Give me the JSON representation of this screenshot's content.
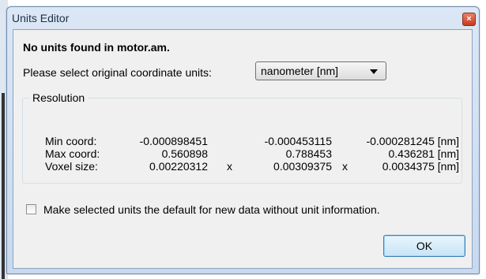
{
  "window": {
    "title": "Units Editor",
    "close_glyph": "×"
  },
  "dialog": {
    "heading": "No units found in motor.am.",
    "units_label": "Please select original coordinate units:",
    "units_select": {
      "selected": "nanometer [nm]"
    },
    "resolution": {
      "title": "Resolution",
      "rows": [
        {
          "label": "Min coord:",
          "v1": "-0.000898451",
          "sep1": "",
          "v2": "-0.000453115",
          "sep2": "",
          "v3": "-0.000281245 [nm]"
        },
        {
          "label": "Max coord:",
          "v1": "0.560898",
          "sep1": "",
          "v2": "0.788453",
          "sep2": "",
          "v3": "0.436281 [nm]"
        },
        {
          "label": "Voxel size:",
          "v1": "0.00220312",
          "sep1": "x",
          "v2": "0.00309375",
          "sep2": "x",
          "v3": "0.0034375 [nm]"
        }
      ]
    },
    "default_checkbox": {
      "label": "Make selected units the default for new data without unit information.",
      "checked": false
    },
    "ok_button": "OK"
  },
  "icons": [
    "close-icon",
    "dropdown-arrow-icon"
  ],
  "colors": {
    "titlebar": "#d3e1f2",
    "client_bg": "#f0f0f0",
    "close_button": "#c63a1e",
    "ok_border": "#3c7fb1"
  }
}
